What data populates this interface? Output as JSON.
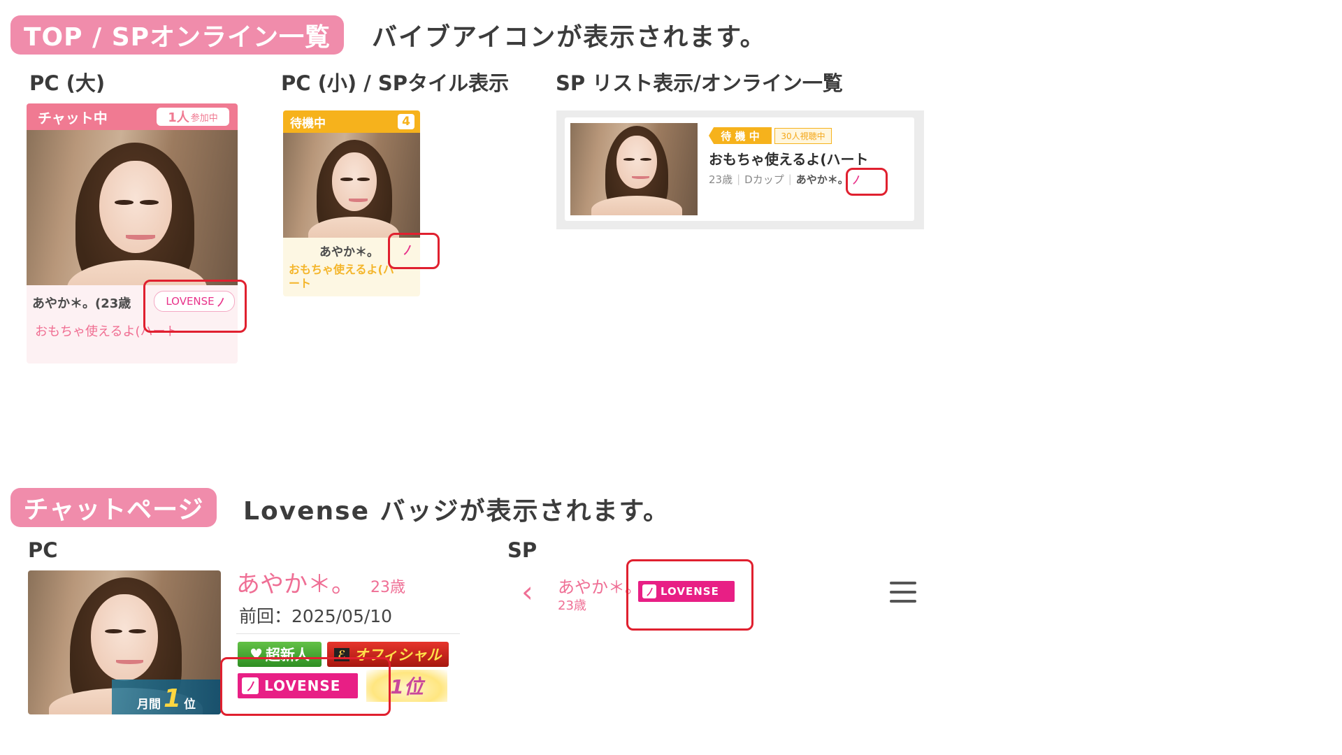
{
  "top_section": {
    "tag": "TOP / SPオンライン一覧",
    "description": "バイブアイコンが表示されます。",
    "pc_large": {
      "title": "PC (大)",
      "status": "チャット中",
      "participants": "1人",
      "participants_suffix": "参加中",
      "name": "あやか＊。(23歳",
      "lovense_label": "LOVENSE",
      "comment": "おもちゃ使えるよ(ハート"
    },
    "pc_small": {
      "title": "PC (小) / SPタイル表示",
      "status": "待機中",
      "count": "4",
      "name": "あやか＊。",
      "comment": "おもちゃ使えるよ(ハ\nート"
    },
    "sp_list": {
      "title": "SP リスト表示/オンライン一覧",
      "status": "待 機 中",
      "viewers": "30人視聴中",
      "comment": "おもちゃ使えるよ(ハート",
      "age": "23歳",
      "cup": "Dカップ",
      "name": "あやか＊。"
    }
  },
  "chat_section": {
    "tag": "チャットページ",
    "description": "Lovense バッジが表示されます。",
    "pc": {
      "title": "PC",
      "name": "あやか＊。",
      "age": "23歳",
      "last_login": "前回：2025/05/10",
      "badge_new": "超新人",
      "badge_official": "オフィシャル",
      "badge_lovense": "LOVENSE",
      "badge_rank": "1位",
      "monthly_rank_prefix": "月間",
      "monthly_rank_num": "1",
      "monthly_rank_suffix": "位"
    },
    "sp": {
      "title": "SP",
      "name": "あやか＊。",
      "age": "23歳",
      "badge_lovense": "LOVENSE"
    }
  },
  "icons": {
    "vibe": "vibe-icon",
    "back": "chevron-left-icon",
    "menu": "hamburger-menu-icon"
  },
  "colors": {
    "tag_pink": "#f08cab",
    "chat_status": "#f07a92",
    "wait_status": "#f6b21c",
    "lovense_pink": "#e81f85",
    "highlight_red": "#e0202f",
    "name_pink": "#ef6f95"
  }
}
